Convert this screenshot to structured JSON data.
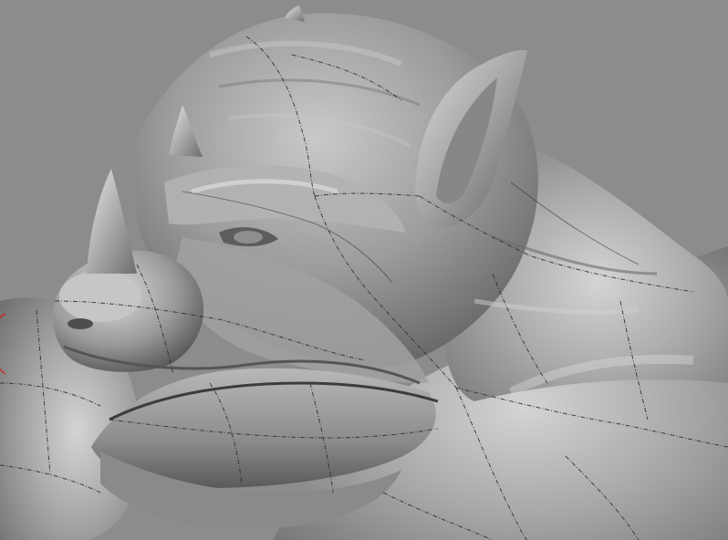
{
  "scene": {
    "view": "3d-viewport",
    "model": "sculpted-creature-head",
    "background_color": "#8c8c8c",
    "material_color": "#a9a9a9",
    "highlight_color": "#e6e6e6",
    "shadow_color": "#4a4a4a",
    "wire_color": "#2a2a2a",
    "brush_cursor_color": "#d11a1a"
  },
  "tools": {
    "brush_cursor": "brush-circle-icon"
  }
}
